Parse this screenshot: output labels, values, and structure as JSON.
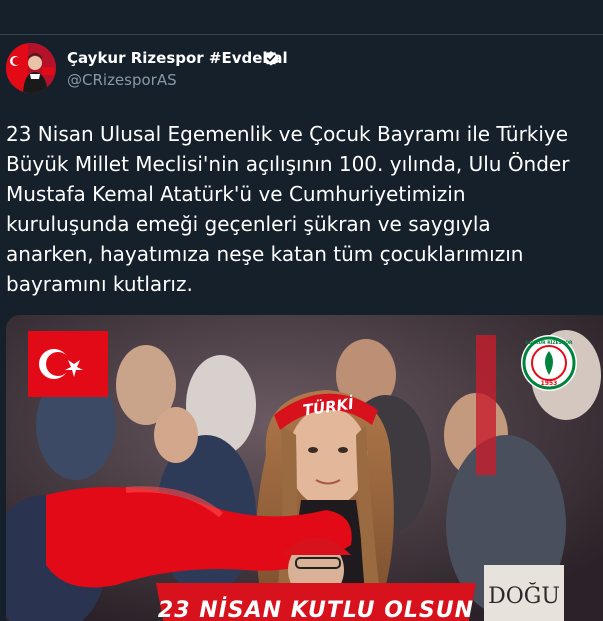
{
  "author": {
    "name": "Çaykur Rizespor #Evdekal",
    "handle": "@CRizesporAS",
    "verified": true,
    "avatar": "avatar-child-with-flag"
  },
  "tweet": {
    "lines": [
      "23 Nisan Ulusal Egemenlik ve Çocuk Bayramı ile Türkiye",
      "Büyük Millet Meclisi'nin açılışının 100. yılında, Ulu Önder",
      "Mustafa Kemal Atatürk'ü ve Cumhuriyetimizin",
      "kuruluşunda emeği geçenleri şükran ve saygıyla",
      "anarken, hayatımıza neşe katan tüm çocuklarımızın",
      "bayramını kutlarız."
    ]
  },
  "media": {
    "scarf_text": "TÜRKİ",
    "banner_text": "23 NİSAN KUTLU OLSUN",
    "sign_text": "DOĞU",
    "logo_top_text": "ÇAYKUR RİZESPOR",
    "logo_year": "1953"
  },
  "colors": {
    "background": "#15202b",
    "text": "#ffffff",
    "secondary_text": "#8899a6",
    "verified": "#ffffff",
    "turkish_red": "#e30a17",
    "rizespor_green": "#00843d"
  }
}
